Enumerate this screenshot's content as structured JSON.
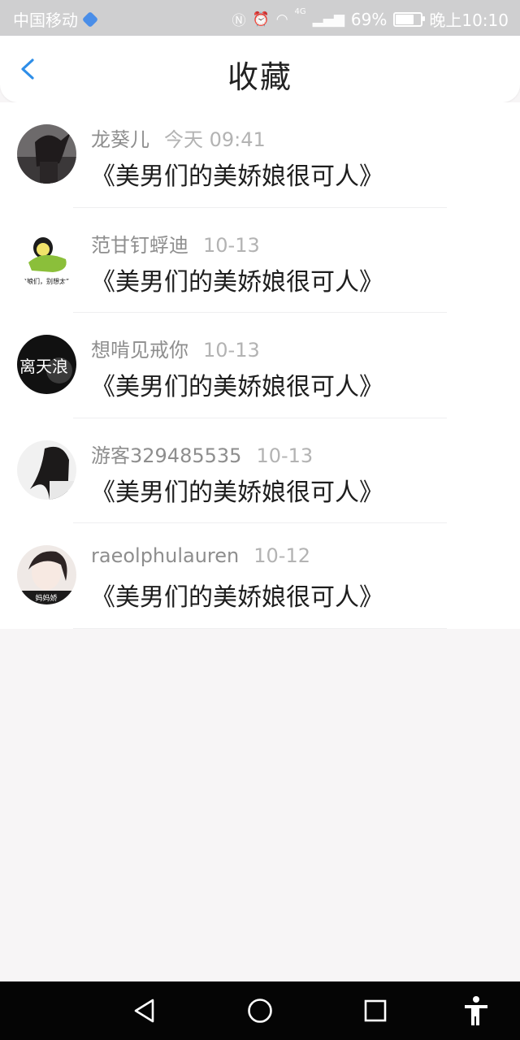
{
  "status_bar": {
    "carrier": "中国移动",
    "signal_type": "4G",
    "battery": "69%",
    "battery_level": 0.69,
    "time": "晚上10:10"
  },
  "header": {
    "title": "收藏",
    "back_icon": "chevron-left-icon"
  },
  "favorites": [
    {
      "user": "龙葵儿",
      "time": "今天 09:41",
      "title": "《美男们的美娇娘很可人》",
      "avatar_text": ""
    },
    {
      "user": "范甘钉蜉迪",
      "time": "10-13",
      "title": "《美男们的美娇娘很可人》",
      "avatar_text": "“娘们，别想太”"
    },
    {
      "user": "想啃见戒你",
      "time": "10-13",
      "title": "《美男们的美娇娘很可人》",
      "avatar_text": "离天浪"
    },
    {
      "user": "游客329485535",
      "time": "10-13",
      "title": "《美男们的美娇娘很可人》",
      "avatar_text": ""
    },
    {
      "user": "raeolphulauren",
      "time": "10-12",
      "title": "《美男们的美娇娘很可人》",
      "avatar_text": "妈妈娇"
    }
  ],
  "nav_buttons": [
    "back-triangle-icon",
    "home-circle-icon",
    "recents-square-icon",
    "accessibility-icon"
  ],
  "colors": {
    "accent": "#2e8ee8",
    "background": "#f7f5f6"
  }
}
